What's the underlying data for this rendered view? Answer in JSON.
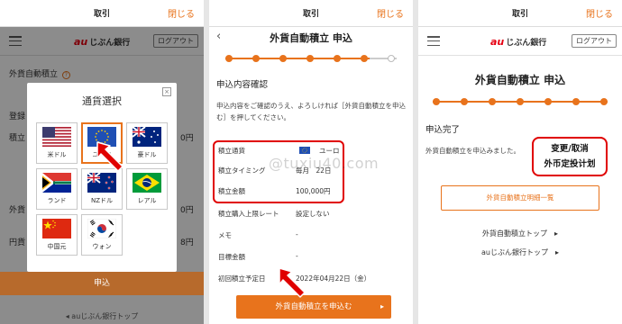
{
  "topbar": {
    "title": "取引",
    "close_label": "閉じる"
  },
  "logo": {
    "au": "au",
    "bank": "じぶん銀行"
  },
  "logout_label": "ログアウト",
  "panel1": {
    "row_title": "外貨自動積立",
    "row_badge": "?",
    "row_tori": "登録",
    "row_tsumi": "積立",
    "row_gai": "外貨",
    "row_en": "円貨",
    "right_1": "0円",
    "right_2": "0円",
    "right_3": "8円",
    "modal_title": "通貨選択",
    "modal_close": "×",
    "currencies": [
      {
        "label": "米ドル",
        "flag": "us-flag-icon"
      },
      {
        "label": "ユーロ",
        "flag": "eu-flag-icon"
      },
      {
        "label": "豪ドル",
        "flag": "au-flag-icon"
      },
      {
        "label": "ランド",
        "flag": "za-flag-icon"
      },
      {
        "label": "NZドル",
        "flag": "nz-flag-icon"
      },
      {
        "label": "レアル",
        "flag": "br-flag-icon"
      },
      {
        "label": "中国元",
        "flag": "cn-flag-icon"
      },
      {
        "label": "ウォン",
        "flag": "kr-flag-icon"
      }
    ],
    "selected": "ユーロ",
    "apply_label": "申込",
    "footer_link": "◂ auじぶん銀行トップ"
  },
  "panel2": {
    "back": "‹",
    "heading": "外貨自動積立 申込",
    "section": "申込内容確認",
    "description": "申込内容をご確認のうえ、よろしければ［外貨自動積立を申込む］を押してください。",
    "rows": [
      {
        "key": "積立通貨",
        "value": "ユーロ"
      },
      {
        "key": "積立タイミング",
        "value": "毎月　22日"
      },
      {
        "key": "積立金額",
        "value": "100,000円"
      },
      {
        "key": "積立購入上限レート",
        "value": "設定しない"
      },
      {
        "key": "メモ",
        "value": "-"
      },
      {
        "key": "目標金額",
        "value": "-"
      },
      {
        "key": "初回積立予定日",
        "value": "2022年04月22日（金）"
      }
    ],
    "button_label": "外貨自動積立を申込む",
    "button_chevron": "▸"
  },
  "panel3": {
    "heading": "外貨自動積立 申込",
    "done": "申込完了",
    "message": "外貨自動積立を申込みました。",
    "callout_line1": "变更/取消",
    "callout_line2": "外币定投计划",
    "detail_button": "外貨自動積立明細一覧",
    "link1": "外貨自動積立トップ　▸",
    "link2": "auじぶん銀行トップ　▸"
  },
  "watermark": "@tuxiu40.com",
  "colors": {
    "accent": "#e8731c",
    "highlight": "#e00000"
  }
}
